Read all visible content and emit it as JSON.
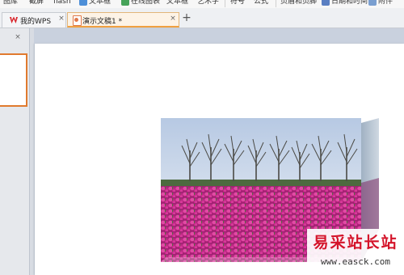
{
  "ribbon": {
    "items": [
      "图库",
      "截屏",
      "flash",
      "文本框",
      "在线图表",
      "文本框",
      "艺术字",
      "符号",
      "公式",
      "页眉和页脚",
      "日期和时间",
      "附件"
    ]
  },
  "tabs": [
    {
      "label": "我的WPS",
      "close": "×",
      "icon": "wps-logo-icon"
    },
    {
      "label": "演示文稿1 *",
      "close": "×",
      "icon": "presentation-icon"
    }
  ],
  "add_tab": "+",
  "panel": {
    "close": "×"
  },
  "accent_colors": {
    "active_tab": "#f0a040",
    "thumbnail_border": "#e07a2e",
    "wps_logo": "#d9262c"
  },
  "slide": {
    "image": {
      "subject": "tulip field with row of trees",
      "effect": "3D perspective"
    }
  },
  "watermark": {
    "brand_cn": "易采站长站",
    "url": "www.easck.com",
    "color": "#d4142a"
  }
}
